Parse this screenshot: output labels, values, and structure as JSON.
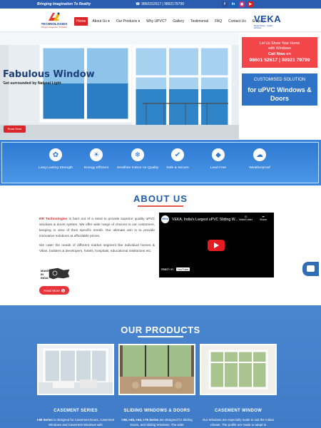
{
  "topbar": {
    "tagline": "Bringing Imagination To Reality",
    "phone": "9860152617 | 9892179799",
    "socials": [
      "facebook",
      "linkedin",
      "instagram",
      "youtube"
    ]
  },
  "header": {
    "logo_name": "TECHNOLOGIES",
    "logo_sub": "Bringing Imagination To Reality",
    "nav": [
      "Home",
      "About Us ▾",
      "Our Products ▾",
      "Why UPVC?",
      "Gallery",
      "Testimonial",
      "FAQ",
      "Contact Us",
      "Enquiry"
    ],
    "veka": "VEKA",
    "veka_sub": "Bridge Partner · Quality Windows"
  },
  "hero": {
    "title": "Fabulous Window",
    "subtitle": "Get surrounded by Natural Light",
    "button": "Read More",
    "arrow_left": "‹",
    "arrow_right": "›"
  },
  "card_red": {
    "line1": "Let Us Show Your Home",
    "line2": "with Windows",
    "line3": "Call Now on",
    "line4": "98601 52617 | 98921 79799"
  },
  "card_blue": {
    "line1": "CUSTOMISED SOLUTION",
    "line2": "for uPVC Windows & Doors"
  },
  "features": [
    {
      "icon": "leaf-icon",
      "glyph": "✿",
      "label": "Long Lasting Strength"
    },
    {
      "icon": "bulb-icon",
      "glyph": "☀",
      "label": "Energy Efficient"
    },
    {
      "icon": "snowflake-icon",
      "glyph": "❄",
      "label": "Healthier Indoor Air Quality"
    },
    {
      "icon": "shield-icon",
      "glyph": "✔",
      "label": "Safe & Secure"
    },
    {
      "icon": "drop-icon",
      "glyph": "◆",
      "label": "Lead Free"
    },
    {
      "icon": "weather-icon",
      "glyph": "☁",
      "label": "Weatherproof"
    }
  ],
  "about": {
    "title": "ABOUT US",
    "brand": "RR Technologies",
    "para1": " is born out of a need to provide superior quality uPVC windows & doors system. We offer wide range of choices to our customers, keeping in view of their specific needs. Our ultimate aim is to provide innovative solutions at affordable prices.",
    "para2": "We cater the needs of different market segment like individual homes & Villas, builders & developers, hotels, hospitals, educational institutions etc.",
    "make_in_india": "MAKE IN INDIA",
    "button": "Read More"
  },
  "video": {
    "channel": "VEKA",
    "title": "VEKA, India's Largest uPVC Sliding W...",
    "watch_later": "Watch later",
    "share": "Share",
    "watch_on": "Watch on",
    "youtube": "YouTube"
  },
  "products": {
    "title": "OUR PRODUCTS",
    "items": [
      {
        "title": "CASEMENT SERIES",
        "strong": "I-60 Series",
        "desc": " is designed for Casement Doors, Casement Windows and Casement Windows with"
      },
      {
        "title": "SLIDING WINDOWS & DOORS",
        "strong": "I-58, I-63, I-64, I-75 Series",
        "desc": " are designed for Sliding Doors, and Sliding Windows. The wide"
      },
      {
        "title": "CASEMENT WINDOW",
        "strong": "",
        "desc": "Our Windows are especially made to suit the Indian climate. The profile are made to adapt to"
      }
    ]
  },
  "colors": {
    "brand_blue": "#2a5db0",
    "accent_red": "#d9262b",
    "feature_blue": "#3c84d9"
  }
}
